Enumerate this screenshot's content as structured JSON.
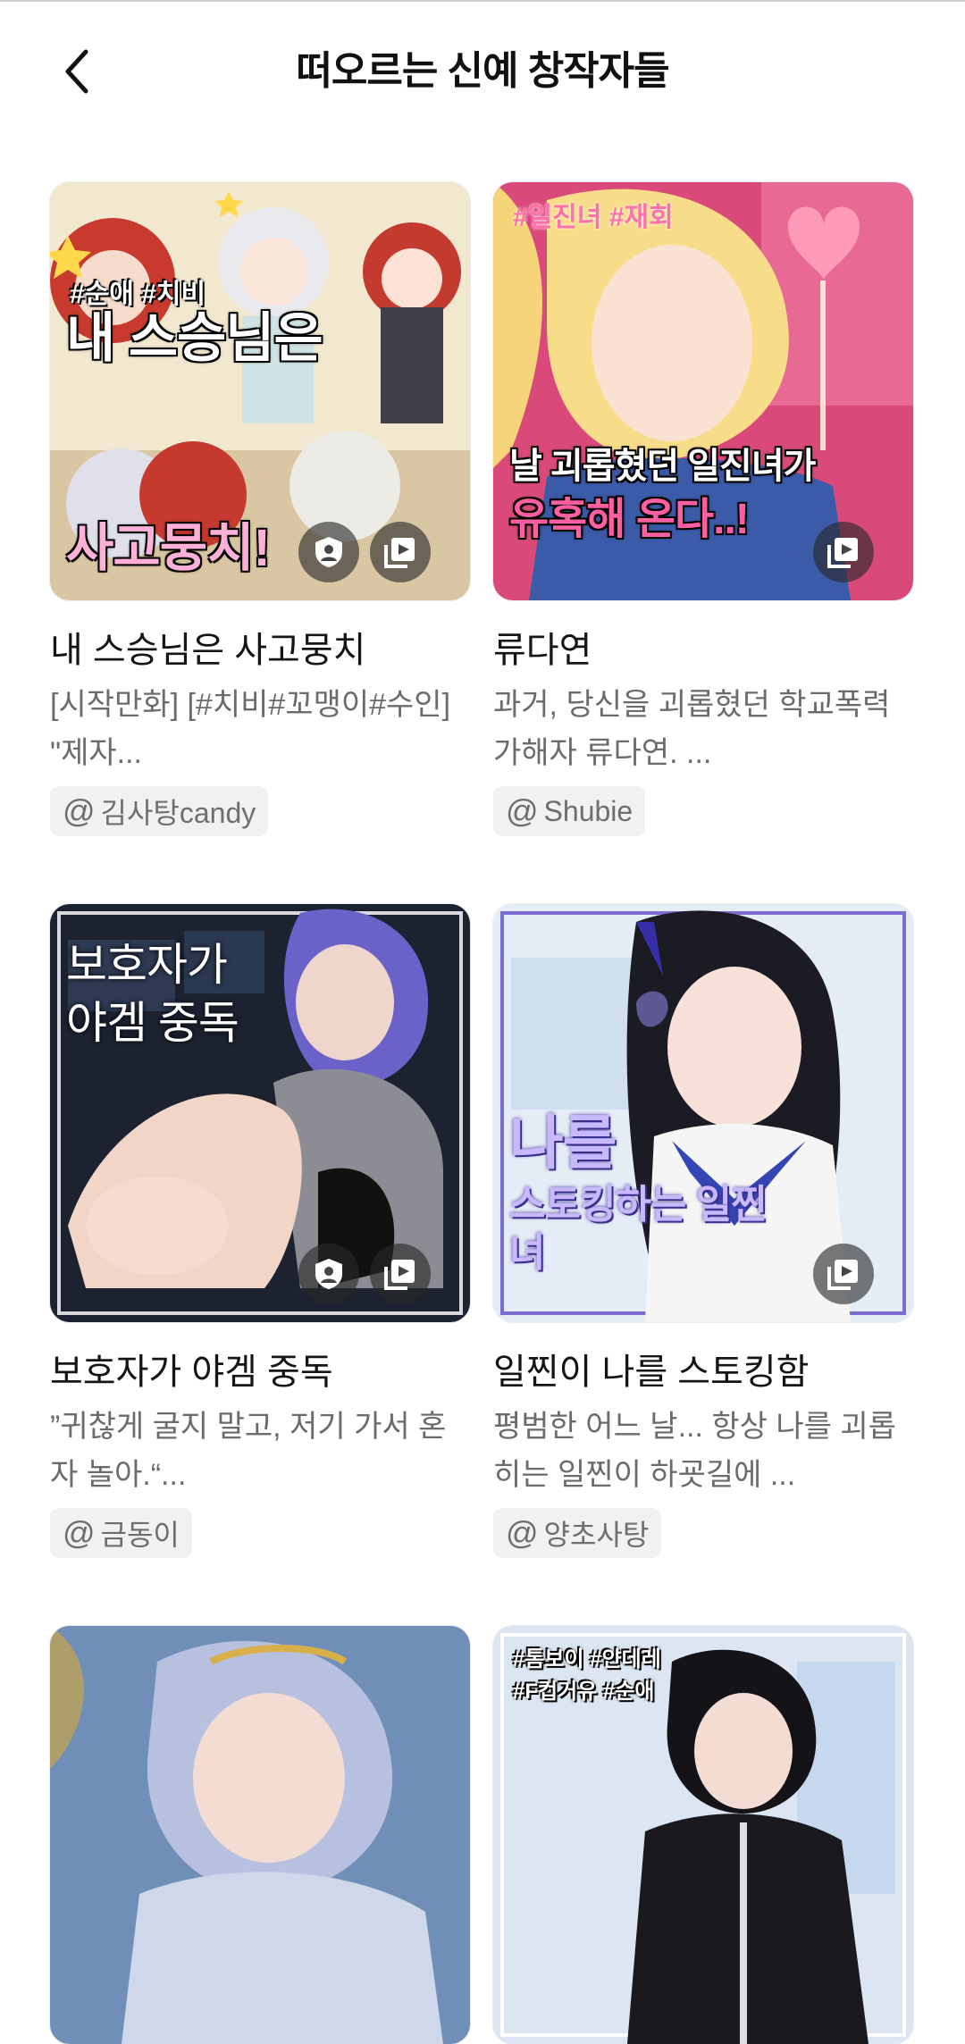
{
  "header": {
    "title": "떠오르는 신예 창작자들",
    "back_icon": "chevron-left-icon"
  },
  "colors": {
    "accent_pink": "#ff4fa0",
    "text_primary": "#151515",
    "text_secondary": "#6b6b6b",
    "chip_bg": "#f1f1f1"
  },
  "cards": [
    {
      "title": "내 스승님은 사고뭉치",
      "description": "[시작만화]\n[#치비#꼬맹이#수인] \"제자...",
      "author": "김사탕candy",
      "thumb_tags": "#순애 #치비",
      "thumb_headline_top": "내 스승님은",
      "thumb_headline_bottom": "사고뭉치!",
      "badges": [
        "shield-person-icon",
        "gallery-icon"
      ]
    },
    {
      "title": "류다연",
      "description": "과거, 당신을 괴롭혔던 학교폭력 가해자 류다연. ...",
      "author": "Shubie",
      "thumb_tags": "#일진녀 #재회",
      "thumb_headline_top": "날 괴롭혔던 일진녀가",
      "thumb_headline_bottom": "유혹해 온다..!",
      "badges": [
        "gallery-icon"
      ]
    },
    {
      "title": "보호자가 야겜 중독",
      "description": "”귀찮게 굴지 말고, 저기 가서 혼자 놀아.“...",
      "author": "금동이",
      "thumb_tags": "",
      "thumb_headline_top": "보호자가",
      "thumb_headline_bottom": "야겜 중독",
      "badges": [
        "shield-person-icon",
        "gallery-icon"
      ]
    },
    {
      "title": "일찐이 나를 스토킹함",
      "description": "평범한 어느 날... 항상 나를 괴롭히는 일찐이 하굣길에 ...",
      "author": "양초사탕",
      "thumb_tags": "",
      "thumb_headline_top": "나를",
      "thumb_headline_bottom": "스토킹하는 일찐녀",
      "badges": [
        "gallery-icon"
      ]
    },
    {
      "title": "",
      "description": "",
      "author": "",
      "thumb_tags": "",
      "thumb_headline_top": "",
      "thumb_headline_bottom": "",
      "badges": []
    },
    {
      "title": "",
      "description": "",
      "author": "",
      "thumb_tags": "#톰보이 #얀데레 #F컵거유 #순애",
      "thumb_headline_top": "",
      "thumb_headline_bottom": "",
      "badges": []
    }
  ]
}
